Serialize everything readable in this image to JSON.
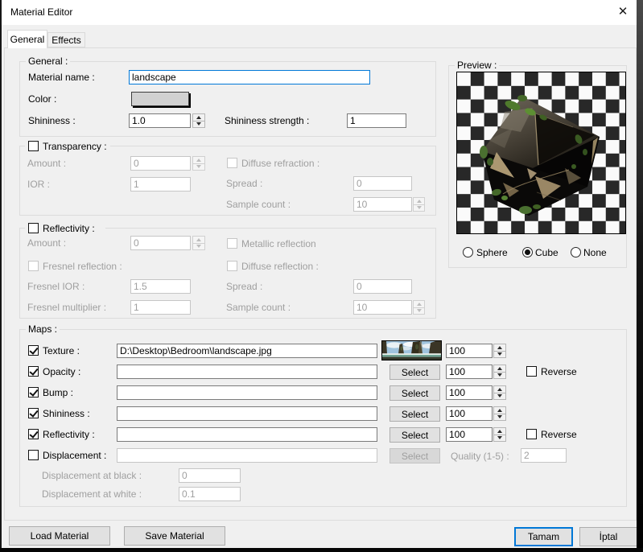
{
  "window": {
    "title": "Material Editor",
    "close_glyph": "✕"
  },
  "tabs": {
    "general": "General",
    "effects": "Effects"
  },
  "general": {
    "legend": "General :",
    "material_name_label": "Material name :",
    "material_name_value": "landscape",
    "color_label": "Color :",
    "shininess_label": "Shininess :",
    "shininess_value": "1.0",
    "shininess_strength_label": "Shininess strength :",
    "shininess_strength_value": "1"
  },
  "transparency": {
    "legend": "Transparency :",
    "amount_label": "Amount :",
    "amount_value": "0",
    "ior_label": "IOR :",
    "ior_value": "1",
    "diffuse_refraction_label": "Diffuse refraction :",
    "spread_label": "Spread :",
    "spread_value": "0",
    "sample_count_label": "Sample count :",
    "sample_count_value": "10"
  },
  "reflectivity": {
    "legend": "Reflectivity :",
    "amount_label": "Amount :",
    "amount_value": "0",
    "fresnel_reflection_label": "Fresnel reflection :",
    "metallic_reflection_label": "Metallic reflection",
    "diffuse_reflection_label": "Diffuse reflection :",
    "fresnel_ior_label": "Fresnel IOR :",
    "fresnel_ior_value": "1.5",
    "fresnel_multiplier_label": "Fresnel multiplier :",
    "fresnel_multiplier_value": "1",
    "spread_label": "Spread :",
    "spread_value": "0",
    "sample_count_label": "Sample count :",
    "sample_count_value": "10"
  },
  "maps": {
    "legend": "Maps :",
    "rows": [
      {
        "label": "Texture :",
        "path": "D:\\Desktop\\Bedroom\\landscape.jpg",
        "amount": "100"
      },
      {
        "label": "Opacity :",
        "path": "",
        "button": "Select",
        "amount": "100",
        "reverse": "Reverse"
      },
      {
        "label": "Bump :",
        "path": "",
        "button": "Select",
        "amount": "100"
      },
      {
        "label": "Shininess :",
        "path": "",
        "button": "Select",
        "amount": "100"
      },
      {
        "label": "Reflectivity :",
        "path": "",
        "button": "Select",
        "amount": "100",
        "reverse": "Reverse"
      },
      {
        "label": "Displacement :",
        "path": "",
        "button": "Select"
      }
    ],
    "quality_label": "Quality (1-5) :",
    "quality_value": "2",
    "disp_black_label": "Displacement at black :",
    "disp_black_value": "0",
    "disp_white_label": "Displacement at white :",
    "disp_white_value": "0.1"
  },
  "preview": {
    "legend": "Preview :",
    "radio_sphere": "Sphere",
    "radio_cube": "Cube",
    "radio_none": "None"
  },
  "footer": {
    "load": "Load Material",
    "save": "Save Material",
    "ok": "Tamam",
    "cancel": "İptal"
  },
  "colors": {
    "accent": "#0078d7",
    "checker_dark": "#282828"
  }
}
